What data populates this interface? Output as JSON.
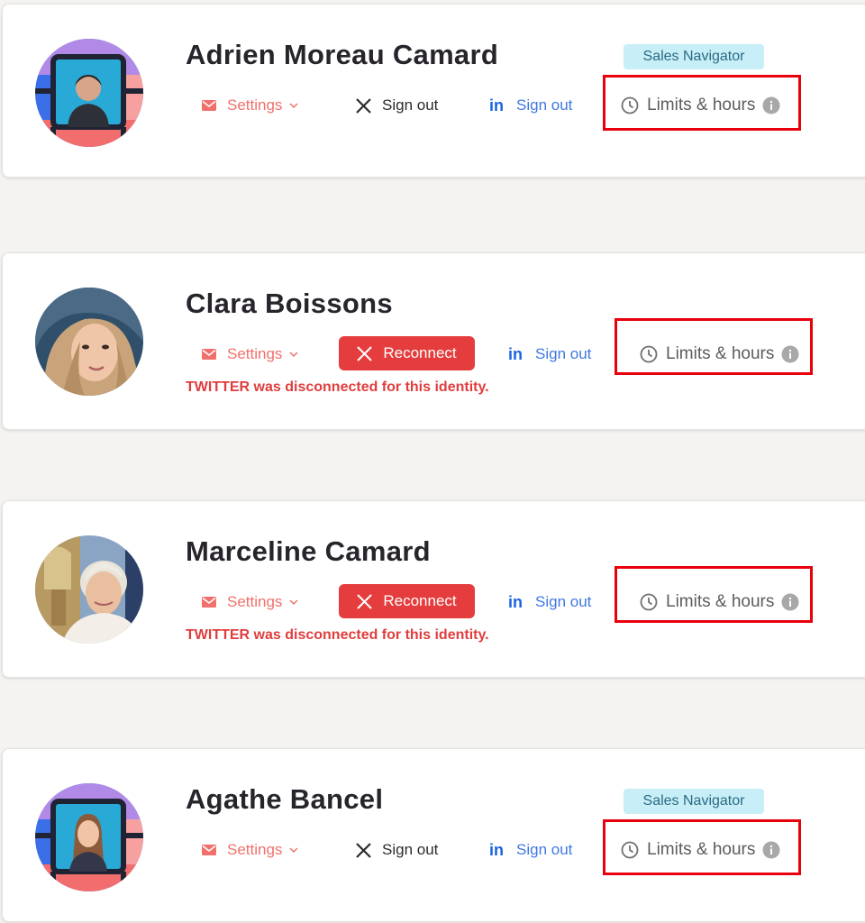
{
  "colors": {
    "settings": "#f2706b",
    "reconnect_bg": "#e53d3d",
    "linkedin": "#3f78e0",
    "error_text": "#e03d3d",
    "badge_bg": "#c8eef8",
    "highlight_border": "#e8000c"
  },
  "identities": [
    {
      "name": "Adrien Moreau Camard",
      "badge": "Sales Navigator",
      "settings_label": "Settings",
      "twitter_label": "Sign out",
      "linkedin_label": "Sign out",
      "limits_label": "Limits & hours",
      "avatar": "avatar-photo-with-grid-frame"
    },
    {
      "name": "Clara Boissons",
      "settings_label": "Settings",
      "twitter_label": "Reconnect",
      "linkedin_label": "Sign out",
      "limits_label": "Limits & hours",
      "error": "TWITTER was disconnected for this identity.",
      "avatar": "avatar-photo"
    },
    {
      "name": "Marceline Camard",
      "settings_label": "Settings",
      "twitter_label": "Reconnect",
      "linkedin_label": "Sign out",
      "limits_label": "Limits & hours",
      "error": "TWITTER was disconnected for this identity.",
      "avatar": "avatar-photo"
    },
    {
      "name": "Agathe Bancel",
      "badge": "Sales Navigator",
      "settings_label": "Settings",
      "twitter_label": "Sign out",
      "linkedin_label": "Sign out",
      "limits_label": "Limits & hours",
      "avatar": "avatar-photo-with-grid-frame"
    }
  ]
}
